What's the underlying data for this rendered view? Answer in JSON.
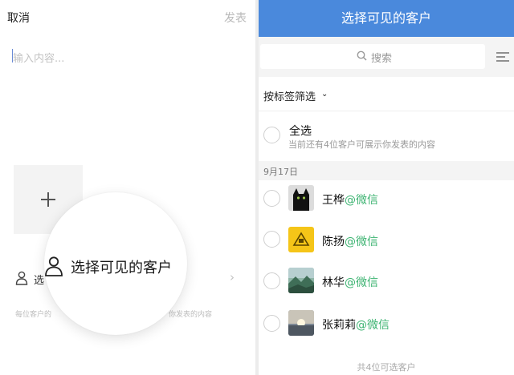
{
  "composer": {
    "cancel_label": "取消",
    "publish_label": "发表",
    "input_placeholder": "输入内容...",
    "add_media_glyph": "+",
    "visibility_row_label": "选",
    "visibility_row_chevron": "›",
    "hint_left": "每位客户的",
    "hint_right": "你发表的内容",
    "magnified_label": "选择可见的客户"
  },
  "picker": {
    "title": "选择可见的客户",
    "search_placeholder": "搜索",
    "filter_label": "按标签筛选",
    "filter_chevron": "⌄",
    "select_all_label": "全选",
    "select_all_subtitle": "当前还有4位客户可展示你发表的内容",
    "date_group": "9月17日",
    "contacts": [
      {
        "name": "王桦",
        "suffix": "@微信",
        "avatar": "black-cat"
      },
      {
        "name": "陈扬",
        "suffix": "@微信",
        "avatar": "yellow-sign"
      },
      {
        "name": "林华",
        "suffix": "@微信",
        "avatar": "landscape"
      },
      {
        "name": "张莉莉",
        "suffix": "@微信",
        "avatar": "sunset"
      }
    ],
    "footer": "共4位可选客户"
  },
  "colors": {
    "header_blue": "#4a89dc",
    "wechat_green": "#3cb371"
  },
  "icons": [
    "person-icon",
    "search-icon",
    "index-list-icon",
    "plus-icon",
    "chevron-right-icon",
    "chevron-down-icon"
  ]
}
